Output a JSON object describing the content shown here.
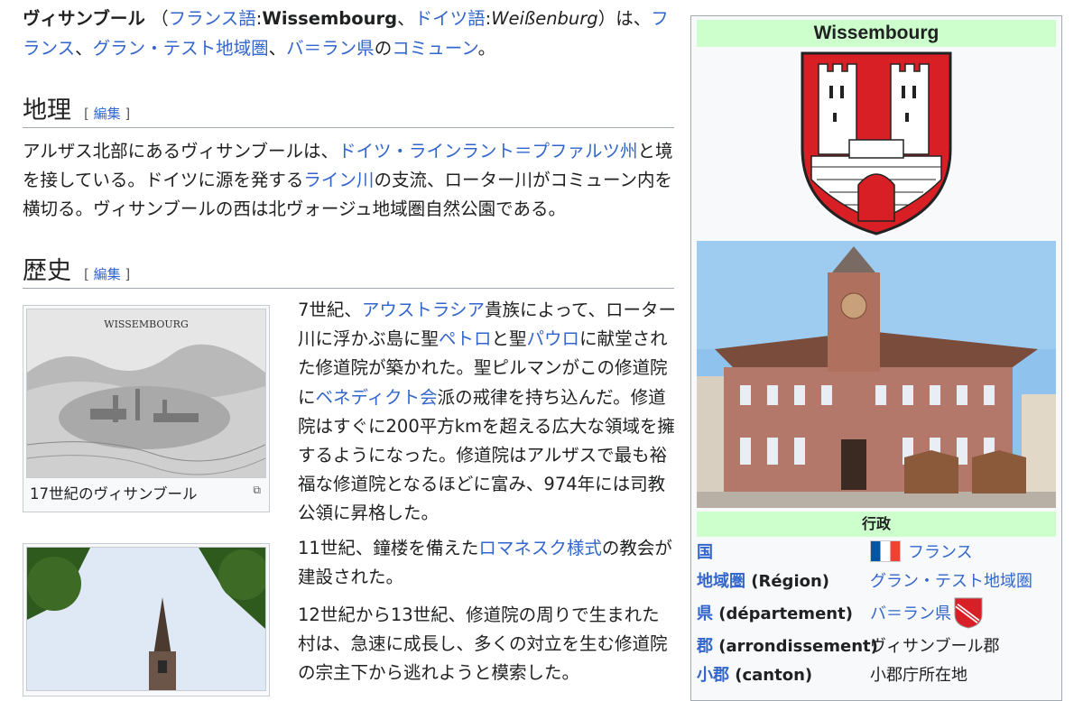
{
  "lead": {
    "title": "ヴィサンブール",
    "paren_open": "（",
    "fr_lang": "フランス語",
    "colon1": ":",
    "fr_name": "Wissembourg",
    "sep1": "、",
    "de_lang": "ドイツ語",
    "colon2": ":",
    "de_name": "Weißenburg",
    "paren_close": "）は、",
    "country": "フランス",
    "sep2": "、",
    "region": "グラン・テスト地域圏",
    "sep3": "、",
    "dept": "バ＝ラン県",
    "no": "の",
    "commune": "コミューン",
    "end": "。"
  },
  "sections": {
    "geo": {
      "heading": "地理",
      "edit_open": "[ ",
      "edit": "編集",
      "edit_close": " ]"
    },
    "hist": {
      "heading": "歴史",
      "edit_open": "[ ",
      "edit": "編集",
      "edit_close": " ]"
    }
  },
  "geo_text": {
    "t1": "アルザス北部にあるヴィサンブールは、",
    "l1": "ドイツ・ラインラント＝プファルツ州",
    "t2": "と境を接している。ドイツに源を発する",
    "l2": "ライン川",
    "t3": "の支流、ローター川がコミューン内を横切る。ヴィサンブールの西は北ヴォージュ地域圏自然公園である。"
  },
  "thumb1": {
    "engraving_title": "WISSEMBOURG",
    "caption": "17世紀のヴィサンブール"
  },
  "hist_text": {
    "p1a": "7世紀、",
    "p1l1": "アウストラシア",
    "p1b": "貴族によって、ローター川に浮かぶ島に聖",
    "p1l2": "ペトロ",
    "p1c": "と聖",
    "p1l3": "パウロ",
    "p1d": "に献堂された修道院が築かれた。聖ピルマンがこの修道院に",
    "p1l4": "ベネディクト会",
    "p1e": "派の戒律を持ち込んだ。修道院はすぐに200平方kmを超える広大な領域を擁するようになった。修道院はアルザスで最も裕福な修道院となるほどに富み、974年には司教公領に昇格した。",
    "p2a": "11世紀、鐘楼を備えた",
    "p2l": "ロマネスク様式",
    "p2b": "の教会が建設された。",
    "p3": "12世紀から13世紀、修道院の周りで生まれた村は、急速に成長し、多くの対立を生む修道院の宗主下から逃れようと模索した。"
  },
  "infobox": {
    "title": "Wissembourg",
    "section": "行政",
    "rows": [
      {
        "k": "国",
        "k_rest": "",
        "v": "フランス",
        "v_link": true
      },
      {
        "k": "地域圏",
        "k_rest": " (Région)",
        "v": "グラン・テスト地域圏",
        "v_link": true
      },
      {
        "k": "県",
        "k_rest": " (département)",
        "v": "バ＝ラン県",
        "v_link": true
      },
      {
        "k": "郡",
        "k_rest": " (arrondissement)",
        "v": "ヴィサンブール郡",
        "v_link": false
      },
      {
        "k": "小郡",
        "k_rest": " (canton)",
        "v": "小郡庁所在地",
        "v_link": false
      }
    ]
  },
  "colors": {
    "link": "#3366cc",
    "infobox_header": "#ccffcc",
    "coat_red": "#d91f26"
  }
}
